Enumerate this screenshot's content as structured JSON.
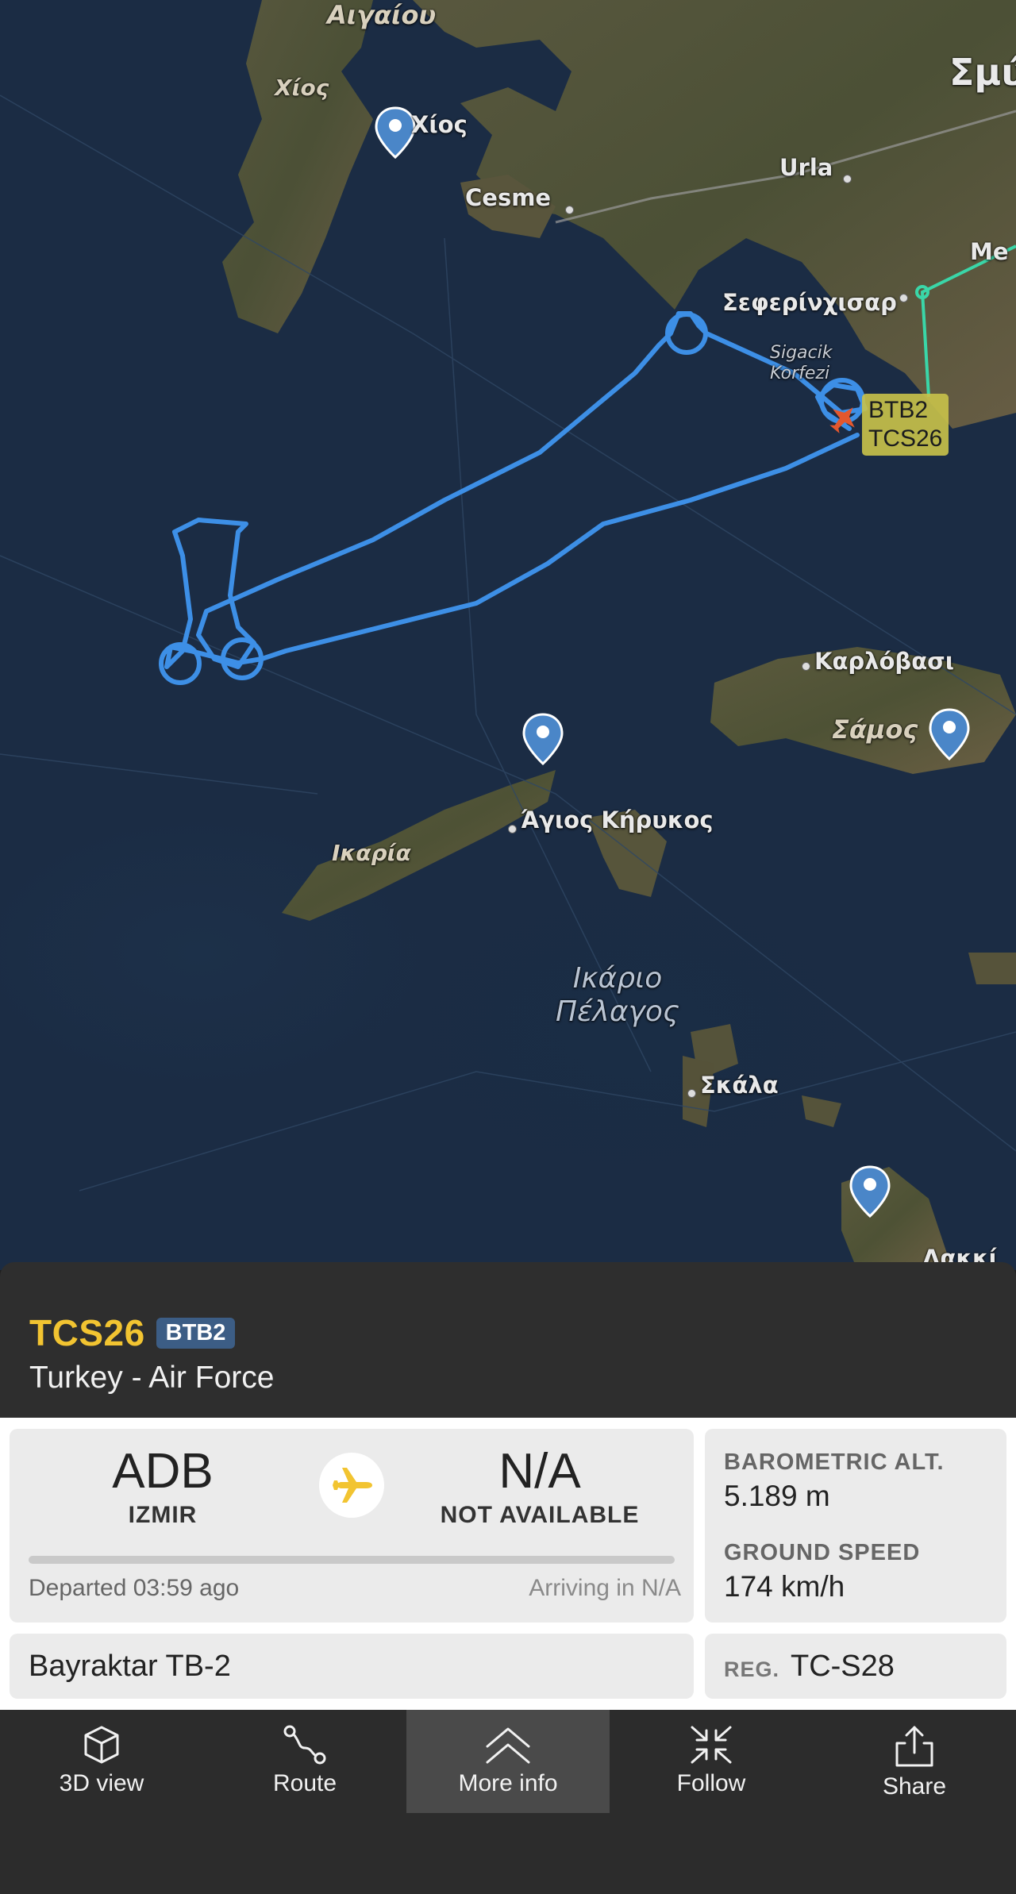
{
  "map": {
    "labels": {
      "aigaiou": "Αιγαίου",
      "chios_island": "Χίος",
      "chios_town": "Χίος",
      "smyrni": "Σμύ",
      "urla": "Urla",
      "cesme": "Cesme",
      "me": "Me",
      "seferihisar": "Σεφερίνχισαρ",
      "sigacik": "Sigacik\nKorfezi",
      "karlovasi": "Καρλόβασι",
      "samos": "Σάμος",
      "agios_kirykos": "Άγιος Κήρυκος",
      "ikaria": "Ικαρία",
      "ikario_pelagos": "Ικάριο\nΠέλαγος",
      "skala": "Σκάλα",
      "lakki": "Λακκί"
    },
    "flight_tag": {
      "line1": "BTB2",
      "line2": "TCS26"
    },
    "track_color": "#3d8fe6"
  },
  "flight": {
    "callsign": "TCS26",
    "type_code": "BTB2",
    "operator": "Turkey - Air Force",
    "origin": {
      "code": "ADB",
      "city": "IZMIR"
    },
    "destination": {
      "code": "N/A",
      "city": "NOT AVAILABLE"
    },
    "progress": 0,
    "departed": "Departed 03:59 ago",
    "arriving": "Arriving in N/A",
    "baro_alt_label": "BAROMETRIC ALT.",
    "baro_alt_value": "5.189 m",
    "ground_speed_label": "GROUND SPEED",
    "ground_speed_value": "174 km/h",
    "aircraft_model": "Bayraktar TB-2",
    "reg_label": "REG.",
    "reg_value": "TC-S28"
  },
  "toolbar": [
    {
      "label": "3D view",
      "icon": "cube-icon"
    },
    {
      "label": "Route",
      "icon": "route-icon"
    },
    {
      "label": "More info",
      "icon": "chevron-up-double-icon",
      "active": true
    },
    {
      "label": "Follow",
      "icon": "follow-arrows-icon"
    },
    {
      "label": "Share",
      "icon": "share-icon"
    }
  ],
  "colors": {
    "accent": "#f2c431",
    "badge": "#3c5d85",
    "panel": "#2e2e2e"
  }
}
